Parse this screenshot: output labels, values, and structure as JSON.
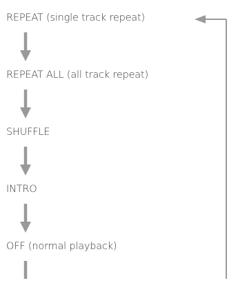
{
  "diagram": {
    "colors": {
      "arrow": "#999999",
      "text": "#3a3a3a",
      "background": "#ffffff"
    },
    "steps": [
      {
        "label": "REPEAT (single track repeat)"
      },
      {
        "label": "REPEAT ALL (all track repeat)"
      },
      {
        "label": "SHUFFLE"
      },
      {
        "label": "INTRO"
      },
      {
        "label": "OFF (normal playback)"
      }
    ]
  }
}
